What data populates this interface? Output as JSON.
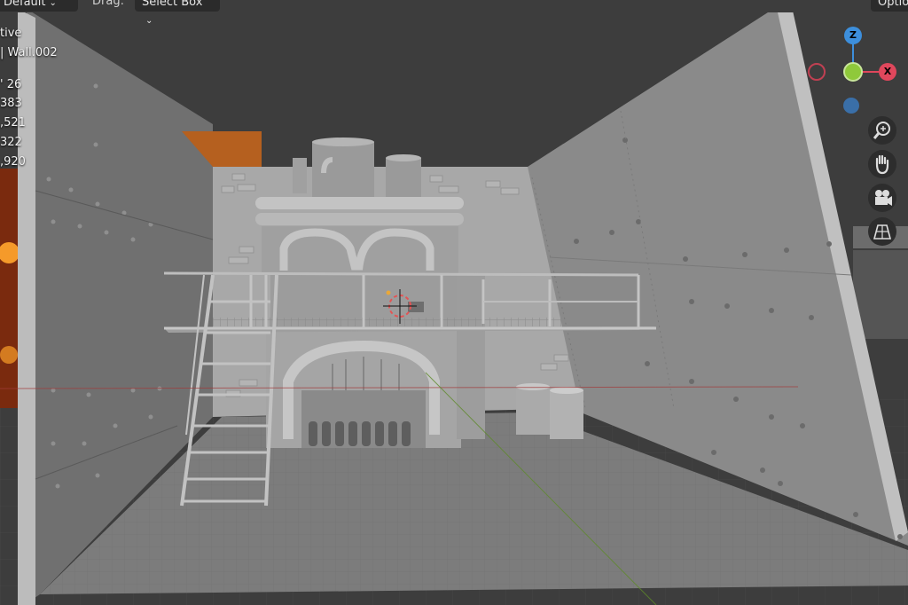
{
  "header": {
    "mode_value": "Default",
    "drag_label": "Drag:",
    "drag_value": "Select Box",
    "options_label": "Optio"
  },
  "overlay": {
    "line1": "tive",
    "line2": "| Wall.002",
    "stats": [
      "' 26",
      "383",
      ",521",
      "322",
      ",920"
    ]
  },
  "gizmo": {
    "z_label": "Z",
    "x_label": "X",
    "colors": {
      "x": "#e0475c",
      "y": "#8fc93a",
      "z": "#3d8fdc"
    }
  },
  "nav_icons": [
    "zoom-icon",
    "pan-hand-icon",
    "camera-icon",
    "ortho-grid-icon"
  ],
  "theme": {
    "header_bg": "#2b2b2b",
    "viewport_bg": "#3d3d3d"
  }
}
